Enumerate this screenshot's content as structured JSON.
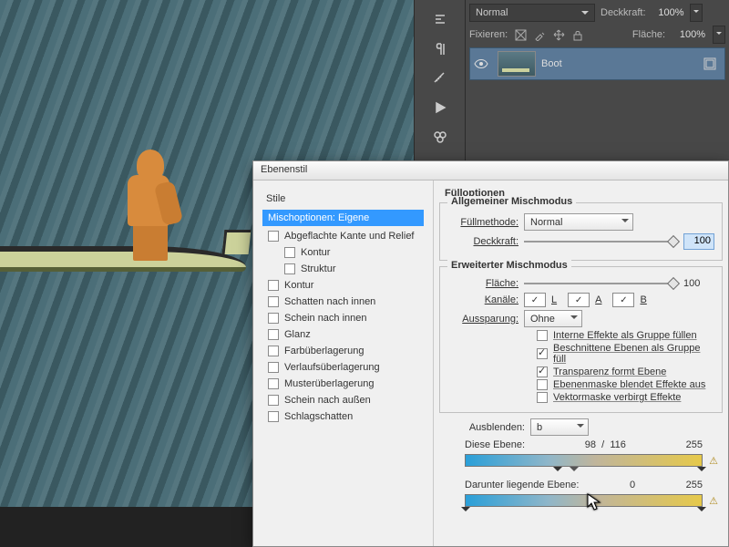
{
  "layers_panel": {
    "blend_mode": "Normal",
    "opacity_label": "Deckkraft:",
    "opacity_value": "100%",
    "lock_label": "Fixieren:",
    "fill_label": "Fläche:",
    "fill_value": "100%",
    "layer_name": "Boot"
  },
  "dialog": {
    "title": "Ebenenstil",
    "sidebar": {
      "header": "Stile",
      "selected": "Mischoptionen: Eigene",
      "items": [
        {
          "label": "Abgeflachte Kante und Relief",
          "indent": false
        },
        {
          "label": "Kontur",
          "indent": true
        },
        {
          "label": "Struktur",
          "indent": true
        },
        {
          "label": "Kontur",
          "indent": false
        },
        {
          "label": "Schatten nach innen",
          "indent": false
        },
        {
          "label": "Schein nach innen",
          "indent": false
        },
        {
          "label": "Glanz",
          "indent": false
        },
        {
          "label": "Farbüberlagerung",
          "indent": false
        },
        {
          "label": "Verlaufsüberlagerung",
          "indent": false
        },
        {
          "label": "Musterüberlagerung",
          "indent": false
        },
        {
          "label": "Schein nach außen",
          "indent": false
        },
        {
          "label": "Schlagschatten",
          "indent": false
        }
      ]
    },
    "fill_options_title": "Fülloptionen",
    "general": {
      "title": "Allgemeiner Mischmodus",
      "method_label": "Füllmethode:",
      "method_value": "Normal",
      "opacity_label": "Deckkraft:",
      "opacity_value": "100"
    },
    "advanced": {
      "title": "Erweiterter Mischmodus",
      "fill_label": "Fläche:",
      "fill_value": "100",
      "channels_label": "Kanäle:",
      "ch_l": "L",
      "ch_a": "A",
      "ch_b": "B",
      "knockout_label": "Aussparung:",
      "knockout_value": "Ohne",
      "opts": [
        {
          "label": "Interne Effekte als Gruppe füllen",
          "on": false
        },
        {
          "label": "Beschnittene Ebenen als Gruppe füll",
          "on": true
        },
        {
          "label": "Transparenz formt Ebene",
          "on": true
        },
        {
          "label": "Ebenenmaske blendet Effekte aus",
          "on": false
        },
        {
          "label": "Vektormaske verbirgt Effekte",
          "on": false
        }
      ]
    },
    "blendif": {
      "label": "Ausblenden:",
      "channel": "b",
      "this_label": "Diese Ebene:",
      "this_low": "98",
      "this_split": "116",
      "this_high": "255",
      "under_label": "Darunter liegende Eben",
      "under_sfx": "e:",
      "under_low": "0",
      "under_high": "255"
    }
  }
}
